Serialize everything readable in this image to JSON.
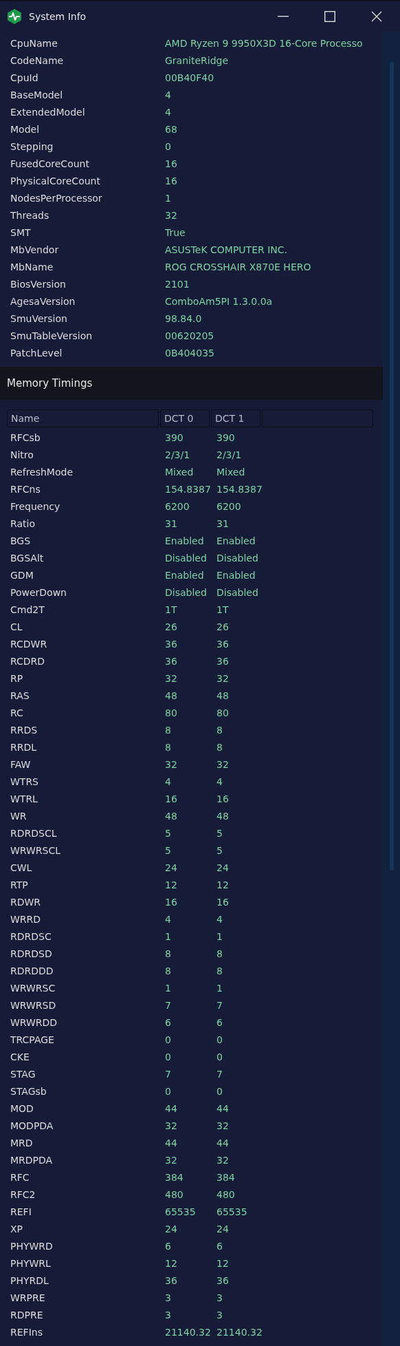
{
  "window": {
    "title": "System Info"
  },
  "info": [
    {
      "label": "CpuName",
      "value": "AMD Ryzen 9 9950X3D 16-Core Processo"
    },
    {
      "label": "CodeName",
      "value": "GraniteRidge"
    },
    {
      "label": "CpuId",
      "value": "00B40F40"
    },
    {
      "label": "BaseModel",
      "value": "4"
    },
    {
      "label": "ExtendedModel",
      "value": "4"
    },
    {
      "label": "Model",
      "value": "68"
    },
    {
      "label": "Stepping",
      "value": "0"
    },
    {
      "label": "FusedCoreCount",
      "value": "16"
    },
    {
      "label": "PhysicalCoreCount",
      "value": "16"
    },
    {
      "label": "NodesPerProcessor",
      "value": "1"
    },
    {
      "label": "Threads",
      "value": "32"
    },
    {
      "label": "SMT",
      "value": "True"
    },
    {
      "label": "MbVendor",
      "value": "ASUSTeK COMPUTER INC."
    },
    {
      "label": "MbName",
      "value": "ROG CROSSHAIR X870E HERO"
    },
    {
      "label": "BiosVersion",
      "value": "2101"
    },
    {
      "label": "AgesaVersion",
      "value": "ComboAm5PI 1.3.0.0a"
    },
    {
      "label": "SmuVersion",
      "value": "98.84.0"
    },
    {
      "label": "SmuTableVersion",
      "value": "00620205"
    },
    {
      "label": "PatchLevel",
      "value": "0B404035"
    }
  ],
  "section": {
    "title": "Memory Timings"
  },
  "table": {
    "columns": [
      "Name",
      "DCT 0",
      "DCT 1"
    ],
    "rows": [
      [
        "RFCsb",
        "390",
        "390"
      ],
      [
        "Nitro",
        "2/3/1",
        "2/3/1"
      ],
      [
        "RefreshMode",
        "Mixed",
        "Mixed"
      ],
      [
        "RFCns",
        "154.8387",
        "154.8387"
      ],
      [
        "Frequency",
        "6200",
        "6200"
      ],
      [
        "Ratio",
        "31",
        "31"
      ],
      [
        "BGS",
        "Enabled",
        "Enabled"
      ],
      [
        "BGSAlt",
        "Disabled",
        "Disabled"
      ],
      [
        "GDM",
        "Enabled",
        "Enabled"
      ],
      [
        "PowerDown",
        "Disabled",
        "Disabled"
      ],
      [
        "Cmd2T",
        "1T",
        "1T"
      ],
      [
        "CL",
        "26",
        "26"
      ],
      [
        "RCDWR",
        "36",
        "36"
      ],
      [
        "RCDRD",
        "36",
        "36"
      ],
      [
        "RP",
        "32",
        "32"
      ],
      [
        "RAS",
        "48",
        "48"
      ],
      [
        "RC",
        "80",
        "80"
      ],
      [
        "RRDS",
        "8",
        "8"
      ],
      [
        "RRDL",
        "8",
        "8"
      ],
      [
        "FAW",
        "32",
        "32"
      ],
      [
        "WTRS",
        "4",
        "4"
      ],
      [
        "WTRL",
        "16",
        "16"
      ],
      [
        "WR",
        "48",
        "48"
      ],
      [
        "RDRDSCL",
        "5",
        "5"
      ],
      [
        "WRWRSCL",
        "5",
        "5"
      ],
      [
        "CWL",
        "24",
        "24"
      ],
      [
        "RTP",
        "12",
        "12"
      ],
      [
        "RDWR",
        "16",
        "16"
      ],
      [
        "WRRD",
        "4",
        "4"
      ],
      [
        "RDRDSC",
        "1",
        "1"
      ],
      [
        "RDRDSD",
        "8",
        "8"
      ],
      [
        "RDRDDD",
        "8",
        "8"
      ],
      [
        "WRWRSC",
        "1",
        "1"
      ],
      [
        "WRWRSD",
        "7",
        "7"
      ],
      [
        "WRWRDD",
        "6",
        "6"
      ],
      [
        "TRCPAGE",
        "0",
        "0"
      ],
      [
        "CKE",
        "0",
        "0"
      ],
      [
        "STAG",
        "7",
        "7"
      ],
      [
        "STAGsb",
        "0",
        "0"
      ],
      [
        "MOD",
        "44",
        "44"
      ],
      [
        "MODPDA",
        "32",
        "32"
      ],
      [
        "MRD",
        "44",
        "44"
      ],
      [
        "MRDPDA",
        "32",
        "32"
      ],
      [
        "RFC",
        "384",
        "384"
      ],
      [
        "RFC2",
        "480",
        "480"
      ],
      [
        "REFI",
        "65535",
        "65535"
      ],
      [
        "XP",
        "24",
        "24"
      ],
      [
        "PHYWRD",
        "6",
        "6"
      ],
      [
        "PHYWRL",
        "12",
        "12"
      ],
      [
        "PHYRDL",
        "36",
        "36"
      ],
      [
        "WRPRE",
        "3",
        "3"
      ],
      [
        "RDPRE",
        "3",
        "3"
      ],
      [
        "REFIns",
        "21140.32",
        "21140.32"
      ]
    ]
  }
}
